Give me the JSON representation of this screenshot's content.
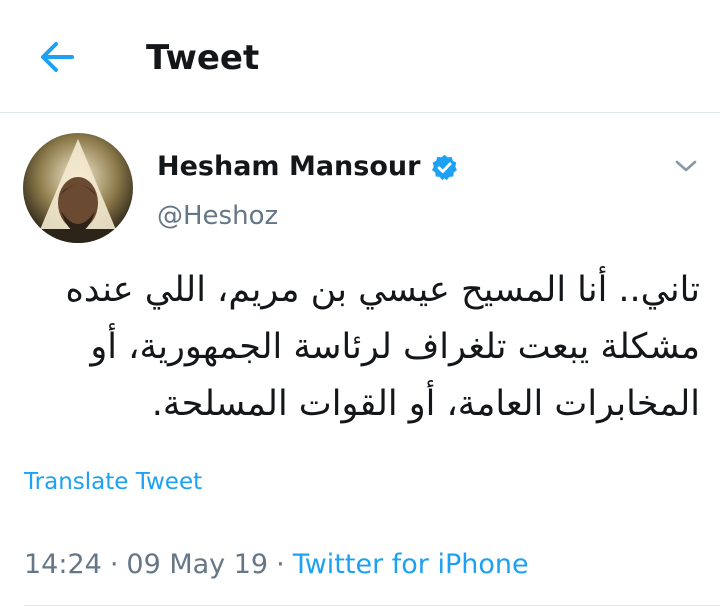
{
  "header": {
    "back_icon": "arrow-left-icon",
    "title": "Tweet"
  },
  "tweet": {
    "author": {
      "display_name": "Hesham Mansour",
      "handle": "@Heshoz",
      "verified_icon": "verified-badge-icon",
      "avatar_icon": "avatar"
    },
    "menu_icon": "chevron-down-icon",
    "text_lines": [
      "تاني.. أنا المسيح عيسي بن مريم، اللي عنده",
      "مشكلة يبعت تلغراف لرئاسة الجمهورية، أو",
      "المخابرات العامة، أو القوات المسلحة."
    ],
    "translate_label": "Translate Tweet",
    "time": "14:24",
    "date": "09 May 19",
    "separator": "·",
    "source": "Twitter for iPhone"
  },
  "colors": {
    "accent": "#1da1f2",
    "text": "#14171a",
    "muted": "#657786",
    "divider": "#e1e8ed"
  }
}
